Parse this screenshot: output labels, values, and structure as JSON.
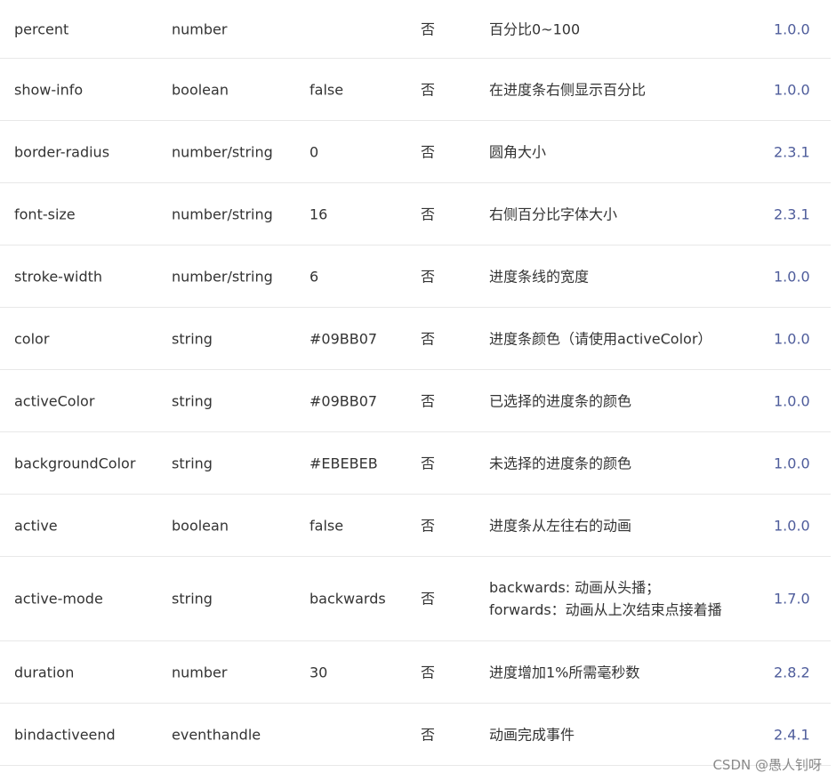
{
  "rows": [
    {
      "name": "percent",
      "type": "number",
      "default": "",
      "required": "否",
      "desc": "百分比0~100",
      "version": "1.0.0"
    },
    {
      "name": "show-info",
      "type": "boolean",
      "default": "false",
      "required": "否",
      "desc": "在进度条右侧显示百分比",
      "version": "1.0.0"
    },
    {
      "name": "border-radius",
      "type": "number/string",
      "default": "0",
      "required": "否",
      "desc": "圆角大小",
      "version": "2.3.1"
    },
    {
      "name": "font-size",
      "type": "number/string",
      "default": "16",
      "required": "否",
      "desc": "右侧百分比字体大小",
      "version": "2.3.1"
    },
    {
      "name": "stroke-width",
      "type": "number/string",
      "default": "6",
      "required": "否",
      "desc": "进度条线的宽度",
      "version": "1.0.0"
    },
    {
      "name": "color",
      "type": "string",
      "default": "#09BB07",
      "required": "否",
      "desc": "进度条颜色（请使用activeColor）",
      "version": "1.0.0"
    },
    {
      "name": "activeColor",
      "type": "string",
      "default": "#09BB07",
      "required": "否",
      "desc": "已选择的进度条的颜色",
      "version": "1.0.0"
    },
    {
      "name": "backgroundColor",
      "type": "string",
      "default": "#EBEBEB",
      "required": "否",
      "desc": "未选择的进度条的颜色",
      "version": "1.0.0"
    },
    {
      "name": "active",
      "type": "boolean",
      "default": "false",
      "required": "否",
      "desc": "进度条从左往右的动画",
      "version": "1.0.0"
    },
    {
      "name": "active-mode",
      "type": "string",
      "default": "backwards",
      "required": "否",
      "desc": "backwards: 动画从头播；forwards：动画从上次结束点接着播",
      "version": "1.7.0"
    },
    {
      "name": "duration",
      "type": "number",
      "default": "30",
      "required": "否",
      "desc": "进度增加1%所需毫秒数",
      "version": "2.8.2"
    },
    {
      "name": "bindactiveend",
      "type": "eventhandle",
      "default": "",
      "required": "否",
      "desc": "动画完成事件",
      "version": "2.4.1"
    }
  ],
  "watermark": "CSDN @愚人钊呀",
  "colors": {
    "text": "#333333",
    "version": "#4e5c9b",
    "divider": "#e8e8e8",
    "watermark": "#8a8a8a"
  }
}
